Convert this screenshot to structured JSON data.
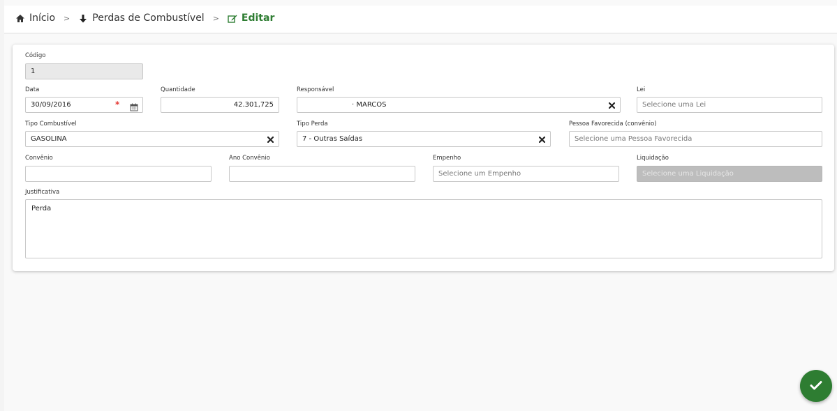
{
  "breadcrumb": {
    "home": "Início",
    "section": "Perdas de Combustível",
    "current": "Editar"
  },
  "form": {
    "codigo": {
      "label": "Código",
      "value": "1"
    },
    "data": {
      "label": "Data",
      "value": "30/09/2016",
      "required_mark": "*"
    },
    "quantidade": {
      "label": "Quantidade",
      "value": "42.301,725"
    },
    "responsavel": {
      "label": "Responsável",
      "value": "· MARCOS"
    },
    "lei": {
      "label": "Lei",
      "placeholder": "Selecione uma Lei"
    },
    "tipo_combustivel": {
      "label": "Tipo Combustível",
      "value": "GASOLINA"
    },
    "tipo_perda": {
      "label": "Tipo Perda",
      "value": "7 - Outras Saídas"
    },
    "pessoa_favorecida": {
      "label": "Pessoa Favorecida (convênio)",
      "placeholder": "Selecione uma Pessoa Favorecida"
    },
    "convenio": {
      "label": "Convênio",
      "value": ""
    },
    "ano_convenio": {
      "label": "Ano Convênio",
      "value": ""
    },
    "empenho": {
      "label": "Empenho",
      "placeholder": "Selecione um Empenho"
    },
    "liquidacao": {
      "label": "Liquidação",
      "placeholder": "Selecione uma Liquidação"
    },
    "justificativa": {
      "label": "Justificativa",
      "value": "Perda"
    }
  },
  "icons": {
    "home": "home-icon",
    "arrow": "arrow-down-icon",
    "edit": "edit-icon",
    "calendar": "calendar-icon",
    "clear": "close-icon",
    "confirm": "check-icon"
  },
  "colors": {
    "accent": "#2e7d32",
    "required": "#e53935"
  }
}
